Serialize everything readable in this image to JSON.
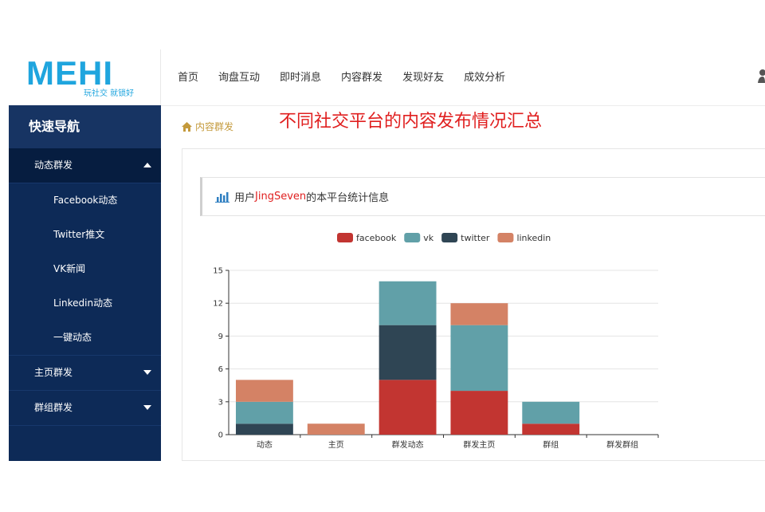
{
  "logo": {
    "text": "MEHI",
    "slogan": "玩社交 就锁好"
  },
  "topnav": [
    "首页",
    "询盘互动",
    "即时消息",
    "内容群发",
    "发现好友",
    "成效分析"
  ],
  "sidebar": {
    "title": "快速导航",
    "group1": "动态群发",
    "sub": [
      "Facebook动态",
      "Twitter推文",
      "VK新闻",
      "Linkedin动态",
      "一键动态"
    ],
    "group2": "主页群发",
    "group3": "群组群发"
  },
  "breadcrumb": "内容群发",
  "annotation": "不同社交平台的内容发布情况汇总",
  "panel": {
    "title_prefix": "用户",
    "username": "JingSeven",
    "title_suffix": "的本平台统计信息"
  },
  "colors": {
    "facebook": "#c23531",
    "vk": "#61a0a8",
    "twitter": "#2f4554",
    "linkedin": "#d48265"
  },
  "chart_data": {
    "type": "bar",
    "stacked": true,
    "categories": [
      "动态",
      "主页",
      "群发动态",
      "群发主页",
      "群组",
      "群发群组"
    ],
    "series": [
      {
        "name": "facebook",
        "values": [
          0,
          0,
          5,
          4,
          1,
          0
        ]
      },
      {
        "name": "twitter",
        "values": [
          1,
          0,
          5,
          0,
          0,
          0
        ]
      },
      {
        "name": "vk",
        "values": [
          2,
          0,
          4,
          6,
          2,
          0
        ]
      },
      {
        "name": "linkedin",
        "values": [
          2,
          1,
          0,
          2,
          0,
          0
        ]
      }
    ],
    "legend": [
      "facebook",
      "vk",
      "twitter",
      "linkedin"
    ],
    "legend_position": "top-center",
    "ylim": [
      0,
      15
    ],
    "yticks": [
      0,
      3,
      6,
      9,
      12,
      15
    ],
    "grid": true
  }
}
